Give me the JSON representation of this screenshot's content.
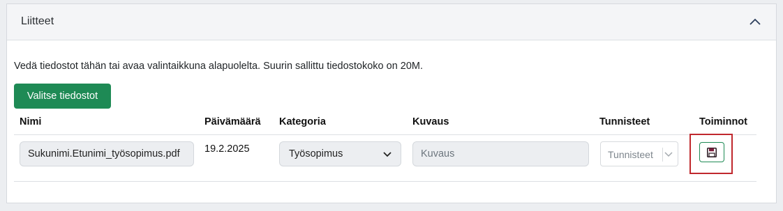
{
  "panel": {
    "title": "Liitteet",
    "collapse_icon": "chevron-up-icon"
  },
  "upload": {
    "hint": "Vedä tiedostot tähän tai avaa valintaikkuna alapuolelta. Suurin sallittu tiedostokoko on 20M.",
    "choose_button_label": "Valitse tiedostot",
    "button_color": "#1e8a55"
  },
  "table": {
    "columns": {
      "name": "Nimi",
      "date": "Päivämäärä",
      "category": "Kategoria",
      "description": "Kuvaus",
      "tags": "Tunnisteet",
      "actions": "Toiminnot"
    },
    "rows": [
      {
        "name": "Sukunimi.Etunimi_työsopimus.pdf",
        "date": "19.2.2025",
        "category": "Työsopimus",
        "description_placeholder": "Kuvaus",
        "tags_placeholder": "Tunnisteet",
        "action_icon": "save-icon",
        "highlight_color": "#c0282d"
      }
    ]
  }
}
